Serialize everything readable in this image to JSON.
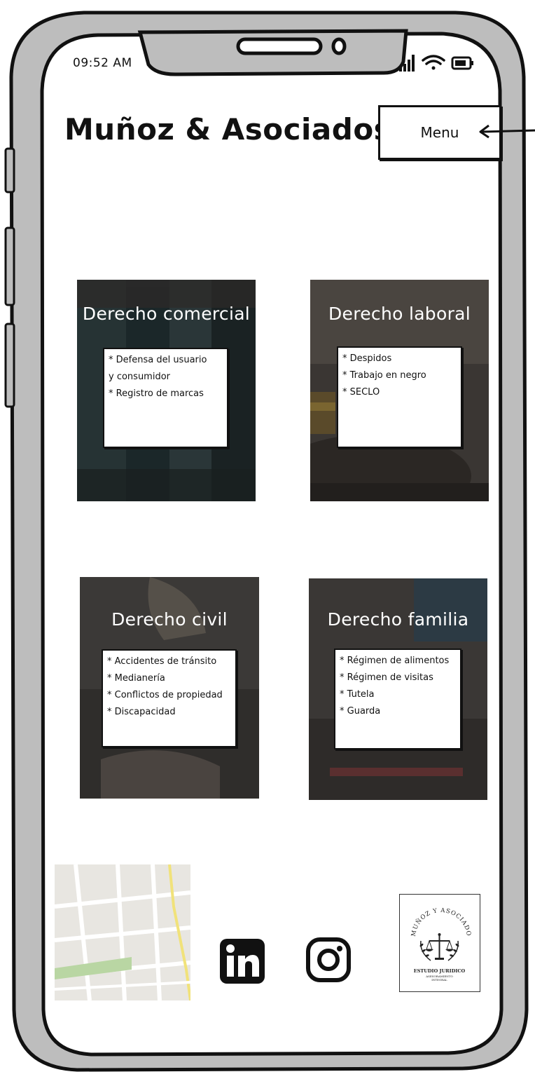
{
  "status_bar": {
    "time": "09:52 AM"
  },
  "header": {
    "title": "Muñoz & Asociados",
    "menu_label": "Menu"
  },
  "cards": [
    {
      "title": "Derecho comercial",
      "items": [
        "* Defensa del usuario",
        "y consumidor",
        "* Registro de marcas"
      ]
    },
    {
      "title": "Derecho laboral",
      "items": [
        "* Despidos",
        "* Trabajo en negro",
        "* SECLO"
      ]
    },
    {
      "title": "Derecho civil",
      "items": [
        "* Accidentes de tránsito",
        "* Medianería",
        "* Conflictos de propiedad",
        "* Discapacidad"
      ]
    },
    {
      "title": "Derecho familia",
      "items": [
        "* Régimen de alimentos",
        "* Régimen de visitas",
        "* Tutela",
        "* Guarda"
      ]
    }
  ],
  "footer": {
    "icons": [
      "map-icon",
      "linkedin-icon",
      "instagram-icon"
    ],
    "logo_text": {
      "arc": "MUÑOZ Y ASOCIADOS",
      "line1": "ESTUDIO JURIDICO",
      "line2": "ASESORAMIENTO",
      "line3": "INTEGRAL"
    }
  },
  "colors": {
    "frame_gray": "#bdbdbd",
    "ink": "#111111",
    "card_dark": "#2a2a2a"
  }
}
